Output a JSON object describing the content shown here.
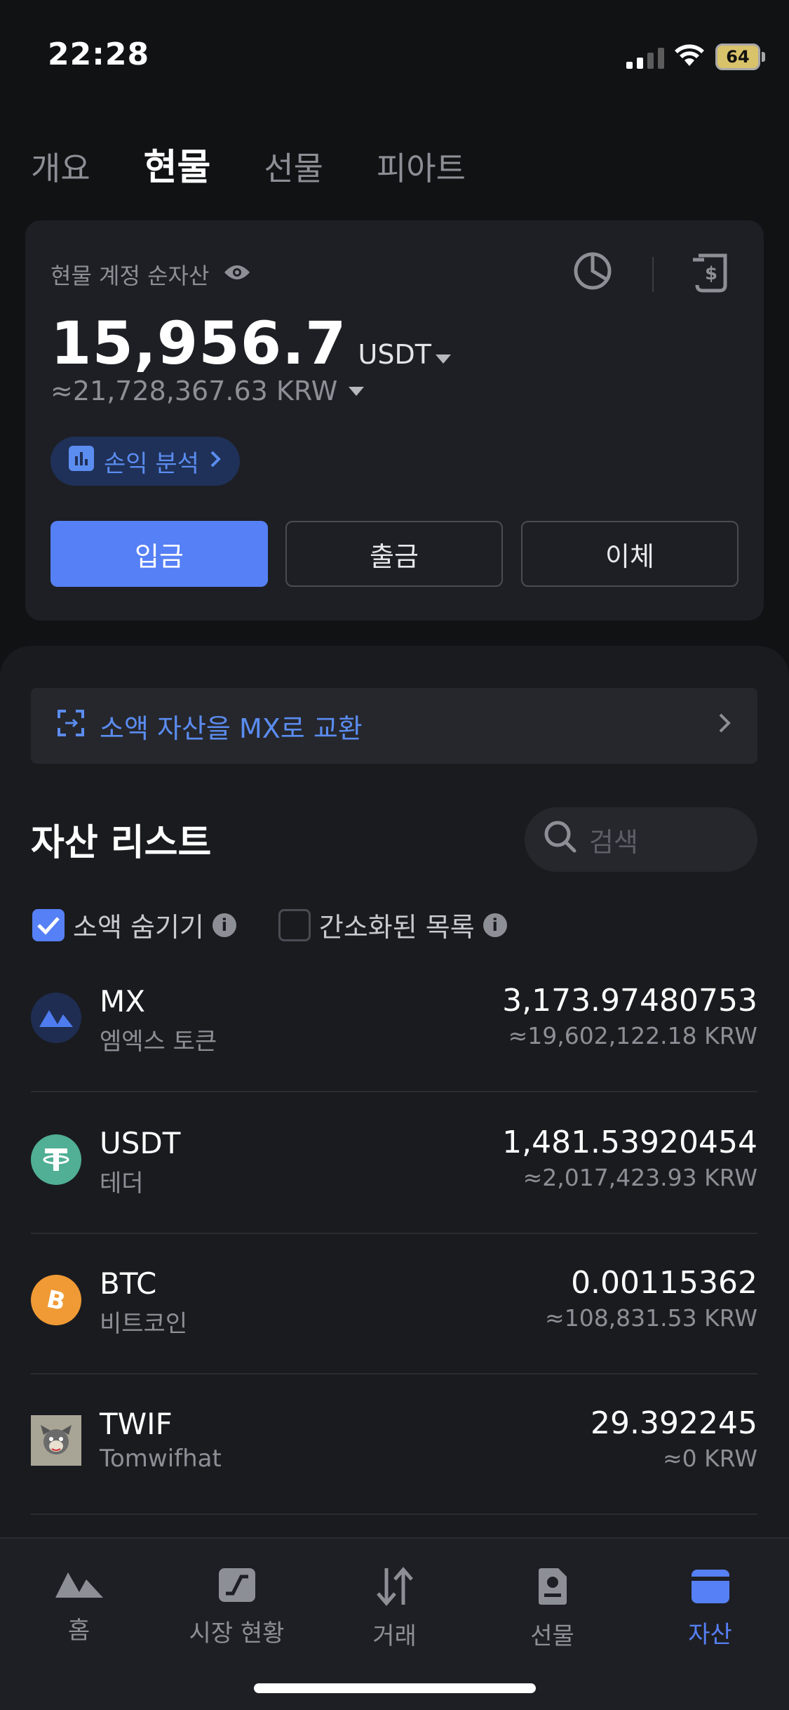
{
  "status": {
    "time": "22:28",
    "battery": "64"
  },
  "tabs": [
    {
      "label": "개요",
      "active": false
    },
    {
      "label": "현물",
      "active": true
    },
    {
      "label": "선물",
      "active": false
    },
    {
      "label": "피아트",
      "active": false
    }
  ],
  "account": {
    "label": "현물 계정 순자산",
    "balance": "15,956.7",
    "unit": "USDT",
    "krw": "≈21,728,367.63 KRW",
    "pnl_label": "손익 분석",
    "buttons": {
      "deposit": "입금",
      "withdraw": "출금",
      "transfer": "이체"
    }
  },
  "convert_banner": "소액 자산을 MX로 교환",
  "asset_list": {
    "title": "자산 리스트",
    "search_placeholder": "검색",
    "filters": {
      "hide_small": "소액 숨기기",
      "hide_small_checked": true,
      "simple_list": "간소화된 목록",
      "simple_list_checked": false
    },
    "items": [
      {
        "symbol": "MX",
        "name": "엠엑스 토큰",
        "amount": "3,173.97480753",
        "krw": "≈19,602,122.18 KRW",
        "icon": "mx-logo-icon",
        "color": "#1f2d52"
      },
      {
        "symbol": "USDT",
        "name": "테더",
        "amount": "1,481.53920454",
        "krw": "≈2,017,423.93 KRW",
        "icon": "tether-logo-icon",
        "color": "#50af95"
      },
      {
        "symbol": "BTC",
        "name": "비트코인",
        "amount": "0.00115362",
        "krw": "≈108,831.53 KRW",
        "icon": "bitcoin-logo-icon",
        "color": "#f09a35"
      },
      {
        "symbol": "TWIF",
        "name": "Tomwifhat",
        "amount": "29.392245",
        "krw": "≈0 KRW",
        "icon": "tomwifhat-logo-icon",
        "color": "#a9a596"
      }
    ]
  },
  "nav": [
    {
      "label": "홈",
      "icon": "home-icon",
      "active": false
    },
    {
      "label": "시장 현황",
      "icon": "market-icon",
      "active": false
    },
    {
      "label": "거래",
      "icon": "trade-icon",
      "active": false
    },
    {
      "label": "선물",
      "icon": "futures-icon",
      "active": false
    },
    {
      "label": "자산",
      "icon": "wallet-icon",
      "active": true
    }
  ],
  "colors": {
    "accent": "#5680f5",
    "background": "#111214",
    "card": "#1e1f24",
    "muted": "#8d8f96"
  }
}
